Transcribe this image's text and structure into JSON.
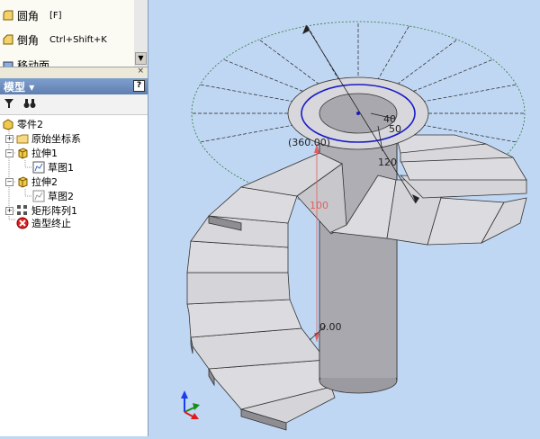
{
  "commands": [
    {
      "label": "圆角",
      "shortcut": "[F]",
      "icon": "fillet-icon"
    },
    {
      "label": "倒角",
      "shortcut": "Ctrl+Shift+K",
      "icon": "chamfer-icon"
    },
    {
      "label": "移动面",
      "shortcut": "",
      "icon": "move-face-icon"
    }
  ],
  "panel": {
    "close_glyph": "×",
    "title": "模型",
    "help_glyph": "?"
  },
  "tree": {
    "root": "零件2",
    "items": [
      {
        "label": "原始坐标系",
        "icon": "folder-icon"
      },
      {
        "label": "拉伸1",
        "icon": "extrude-icon"
      },
      {
        "label": "草图1",
        "icon": "sketch-icon"
      },
      {
        "label": "拉伸2",
        "icon": "extrude-icon"
      },
      {
        "label": "草图2",
        "icon": "sketch-icon"
      },
      {
        "label": "矩形阵列1",
        "icon": "pattern-icon"
      },
      {
        "label": "造型终止",
        "icon": "end-of-part-icon"
      }
    ]
  },
  "dimensions": {
    "angle": "(360.00)",
    "inner": "40",
    "outer": "50",
    "offset": "120",
    "height": "100",
    "base": "0.00"
  },
  "colors": {
    "viewport_bg": "#c0d7f3",
    "accent_blue": "#1a1ac8",
    "dim_red": "#e06060"
  }
}
